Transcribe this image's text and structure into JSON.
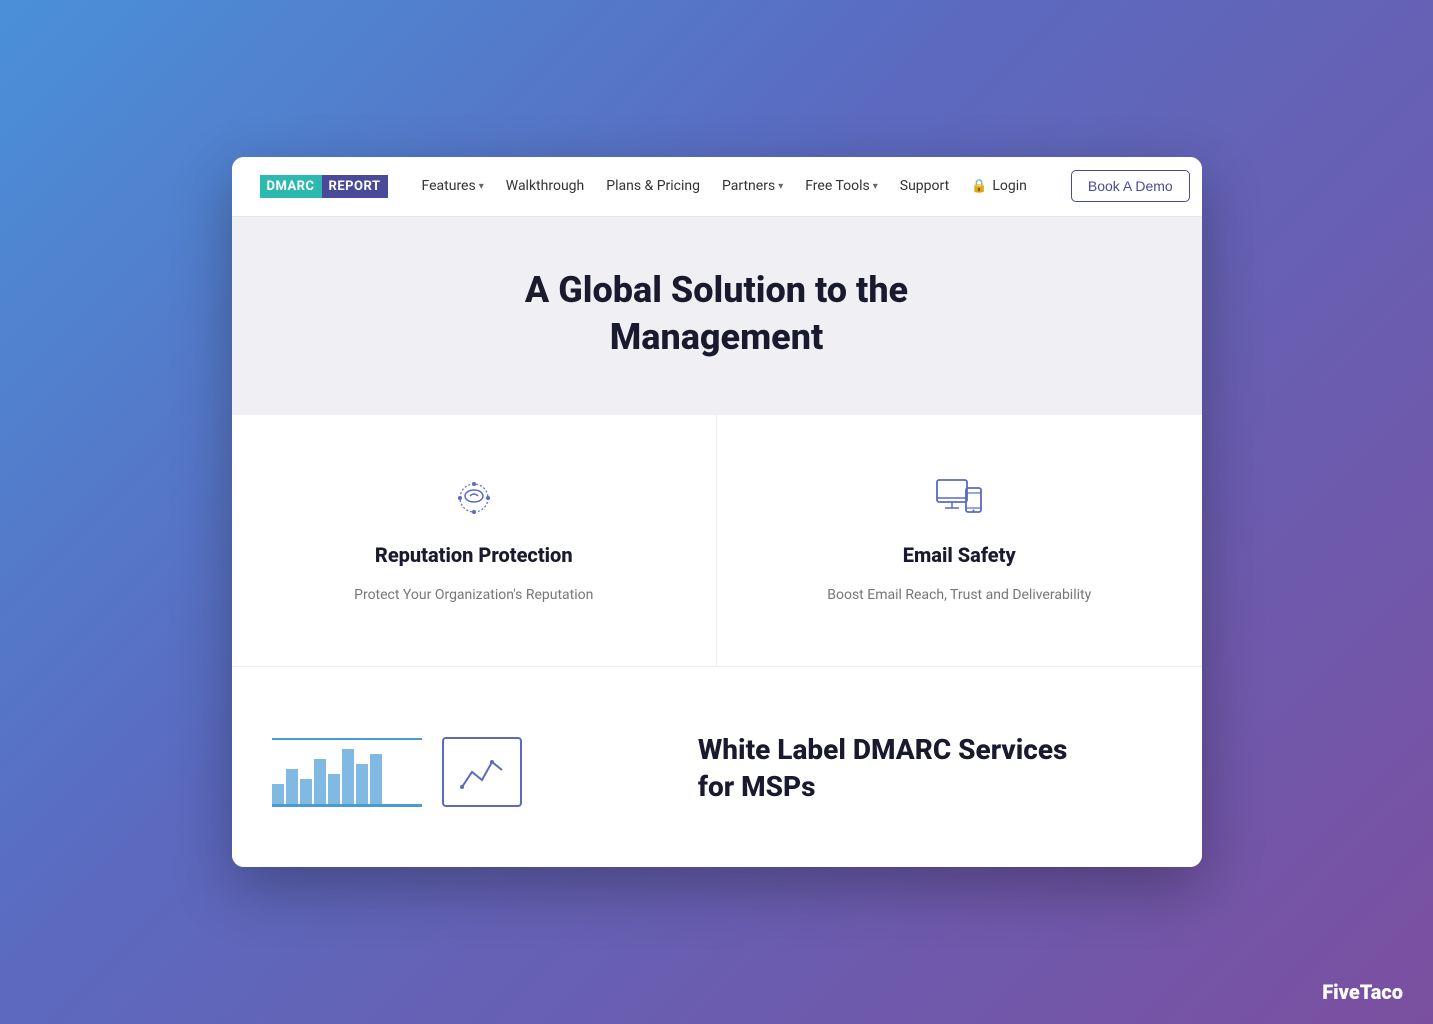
{
  "logo": {
    "dmarc": "DMARC",
    "report": "REPORT"
  },
  "navbar": {
    "features": "Features",
    "walkthrough": "Walkthrough",
    "plans_pricing": "Plans & Pricing",
    "partners": "Partners",
    "free_tools": "Free Tools",
    "support": "Support",
    "login": "Login",
    "book_demo": "Book A Demo"
  },
  "hero": {
    "title_line1": "A Global Solution to the",
    "title_line2": "Management"
  },
  "features": [
    {
      "id": "reputation",
      "title": "Reputation Protection",
      "description": "Protect Your Organization's Reputation"
    },
    {
      "id": "email",
      "title": "Email Safety",
      "description": "Boost Email Reach, Trust and Deliverability"
    }
  ],
  "bottom": {
    "title_line1": "White Label DMARC Services",
    "title_line2": "for MSPs"
  },
  "fivetaco": {
    "label": "FiveTaco"
  }
}
